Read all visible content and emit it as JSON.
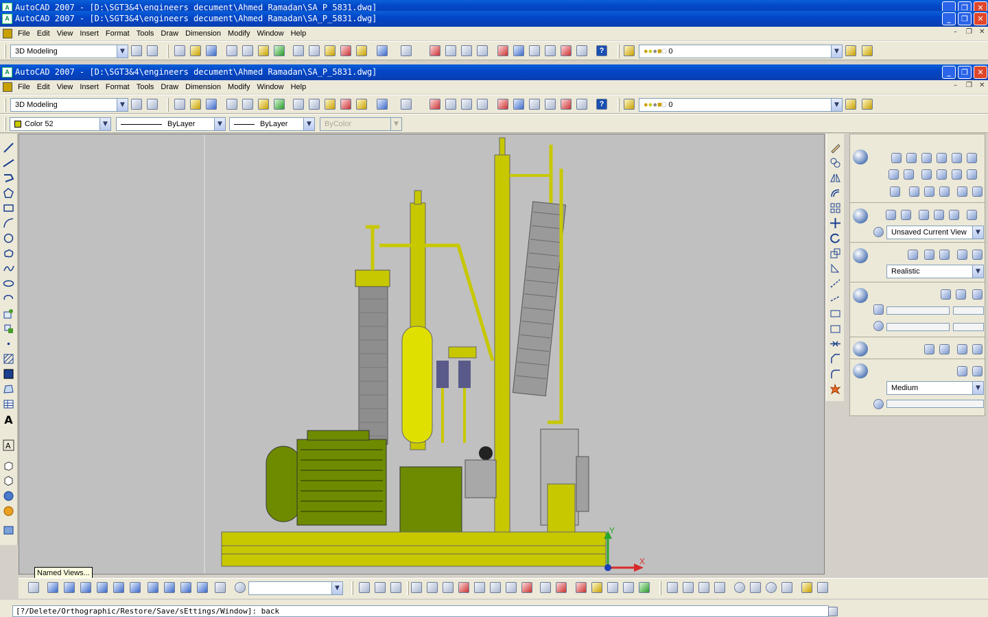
{
  "window": {
    "outer_title": "AutoCAD 2007 - [D:\\SGT3&4\\engineers decument\\Ahmed Ramadan\\SA_P_5831.dwg]",
    "inner_title": "AutoCAD 2007 - [D:\\SGT3&4\\engineers decument\\Ahmed Ramadan\\SA_P_5831.dwg]",
    "app_icon": "A"
  },
  "menu": {
    "items": [
      "File",
      "Edit",
      "View",
      "Insert",
      "Format",
      "Tools",
      "Draw",
      "Dimension",
      "Modify",
      "Window",
      "Help"
    ]
  },
  "toolbar": {
    "workspace": "3D Modeling",
    "layer": "0",
    "help_glyph": "?"
  },
  "properties": {
    "color": "Color 52",
    "linetype": "ByLayer",
    "lineweight": "ByLayer",
    "plotstyle": "ByColor"
  },
  "dashboard": {
    "named_view": "Unsaved Current View",
    "visual_style": "Realistic",
    "render_preset": "Medium"
  },
  "tooltip": "Named Views...",
  "command_line": "[?/Delete/Orthographic/Restore/Save/sEttings/Window]:  back",
  "ucs": {
    "x_label": "X",
    "y_label": "Y"
  },
  "icons": [
    "appicon",
    "minimize-icon",
    "restore-icon",
    "close-icon",
    "line-icon",
    "polyline-icon",
    "circle-icon",
    "arc-icon",
    "rectangle-icon",
    "text-icon",
    "hatch-icon",
    "move-icon",
    "rotate-icon",
    "scale-icon",
    "layer-icon",
    "help-icon",
    "zoom-icon",
    "pan-icon",
    "ucs-icon"
  ],
  "colors": {
    "title_blue": "#0246c8",
    "viewport_bg": "#c0c0c0",
    "model_yellow": "#c8c800",
    "motor_green": "#6e8b00",
    "gray_part": "#8c8c8c"
  }
}
